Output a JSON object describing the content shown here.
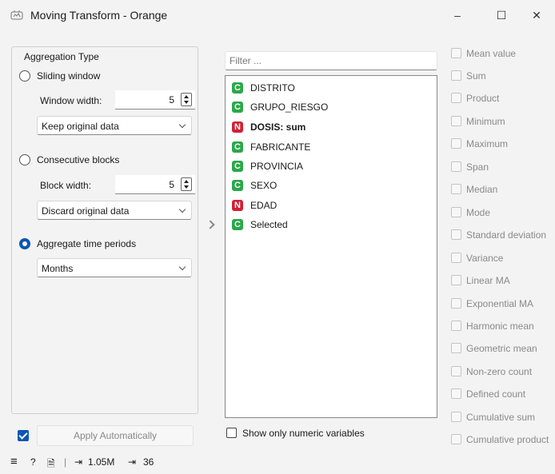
{
  "window": {
    "title": "Moving Transform - Orange",
    "minimize": "–",
    "maximize": "☐",
    "close": "✕",
    "icon": "orange-app-icon"
  },
  "aggregation": {
    "group_title": "Aggregation Type",
    "sliding": {
      "label": "Sliding window",
      "checked": false,
      "width_label": "Window width:",
      "width_value": "5",
      "mode": "Keep original data"
    },
    "consecutive": {
      "label": "Consecutive blocks",
      "checked": false,
      "width_label": "Block width:",
      "width_value": "5",
      "mode": "Discard original data"
    },
    "periods": {
      "label": "Aggregate time periods",
      "checked": true,
      "value": "Months"
    }
  },
  "apply": {
    "label": "Apply Automatically",
    "checked": true
  },
  "status_bar": {
    "menu_icon": "≡",
    "help_icon": "?",
    "report_icon": "🗎",
    "input_icon": "⇥",
    "input_value": "1.05M",
    "output_icon": "⇥",
    "output_value": "36"
  },
  "variables": {
    "filter_placeholder": "Filter ...",
    "items": [
      {
        "type": "C",
        "label": "DISTRITO",
        "bold": false
      },
      {
        "type": "C",
        "label": "GRUPO_RIESGO",
        "bold": false
      },
      {
        "type": "N",
        "label": "DOSIS: sum",
        "bold": true
      },
      {
        "type": "C",
        "label": "FABRICANTE",
        "bold": false
      },
      {
        "type": "C",
        "label": "PROVINCIA",
        "bold": false
      },
      {
        "type": "C",
        "label": "SEXO",
        "bold": false
      },
      {
        "type": "N",
        "label": "EDAD",
        "bold": false
      },
      {
        "type": "C",
        "label": "Selected",
        "bold": false
      }
    ],
    "numeric_only_label": "Show only numeric variables",
    "numeric_only_checked": false
  },
  "aggregations": [
    "Mean value",
    "Sum",
    "Product",
    "Minimum",
    "Maximum",
    "Span",
    "Median",
    "Mode",
    "Standard deviation",
    "Variance",
    "Linear MA",
    "Exponential MA",
    "Harmonic mean",
    "Geometric mean",
    "Non-zero count",
    "Defined count",
    "Cumulative sum",
    "Cumulative product"
  ],
  "colors": {
    "accent": "#0b57b5",
    "categorical": "#2aa84a",
    "numeric": "#d22034"
  }
}
